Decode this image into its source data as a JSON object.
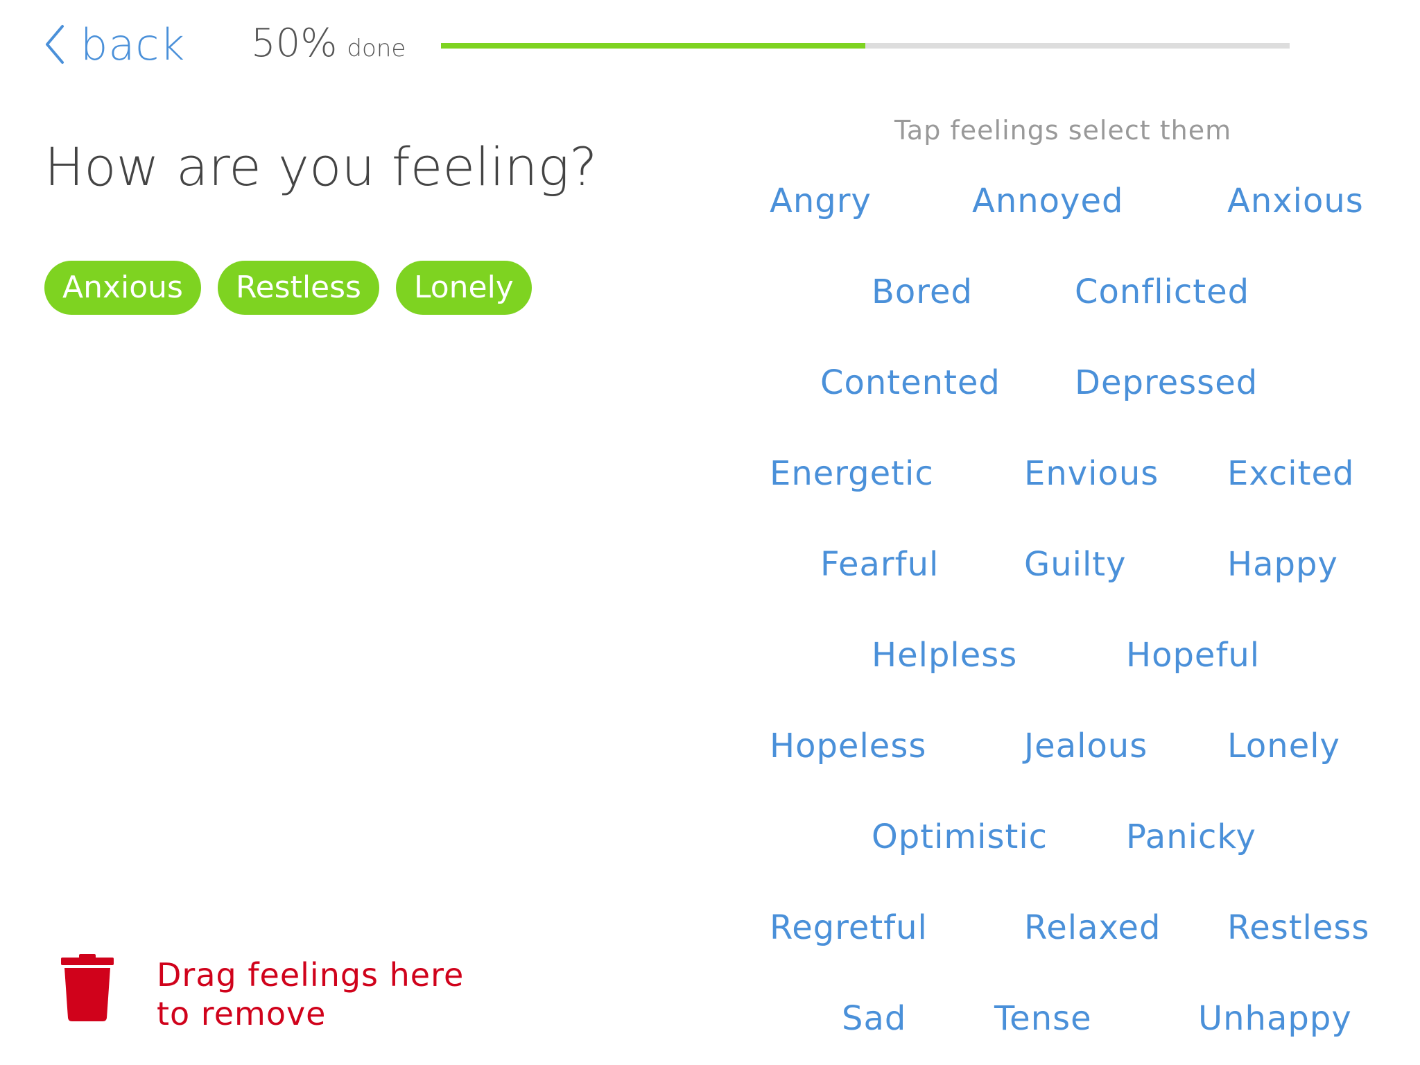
{
  "nav": {
    "back_label": "back"
  },
  "progress": {
    "percent_label": "50%",
    "done_label": "done",
    "fraction": 0.5
  },
  "page_title": "How are you feeling?",
  "selected_feelings": [
    "Anxious",
    "Restless",
    "Lonely"
  ],
  "remove_zone": {
    "line1": "Drag feelings here",
    "line2": "to remove",
    "icon": "trash-icon"
  },
  "hint": "Tap feelings select them",
  "feelings": [
    [
      "Angry",
      "Annoyed",
      "Anxious"
    ],
    [
      "Bored",
      "Conflicted"
    ],
    [
      "Contented",
      "Depressed"
    ],
    [
      "Energetic",
      "Envious",
      "Excited"
    ],
    [
      "Fearful",
      "Guilty",
      "Happy"
    ],
    [
      "Helpless",
      "Hopeful"
    ],
    [
      "Hopeless",
      "Jealous",
      "Lonely"
    ],
    [
      "Optimistic",
      "Panicky"
    ],
    [
      "Regretful",
      "Relaxed",
      "Restless"
    ],
    [
      "Sad",
      "Tense",
      "Unhappy"
    ]
  ],
  "colors": {
    "accent_blue": "#4a90d9",
    "accent_green": "#7ed321",
    "remove_red": "#d0021b",
    "track_gray": "#dddddd"
  }
}
